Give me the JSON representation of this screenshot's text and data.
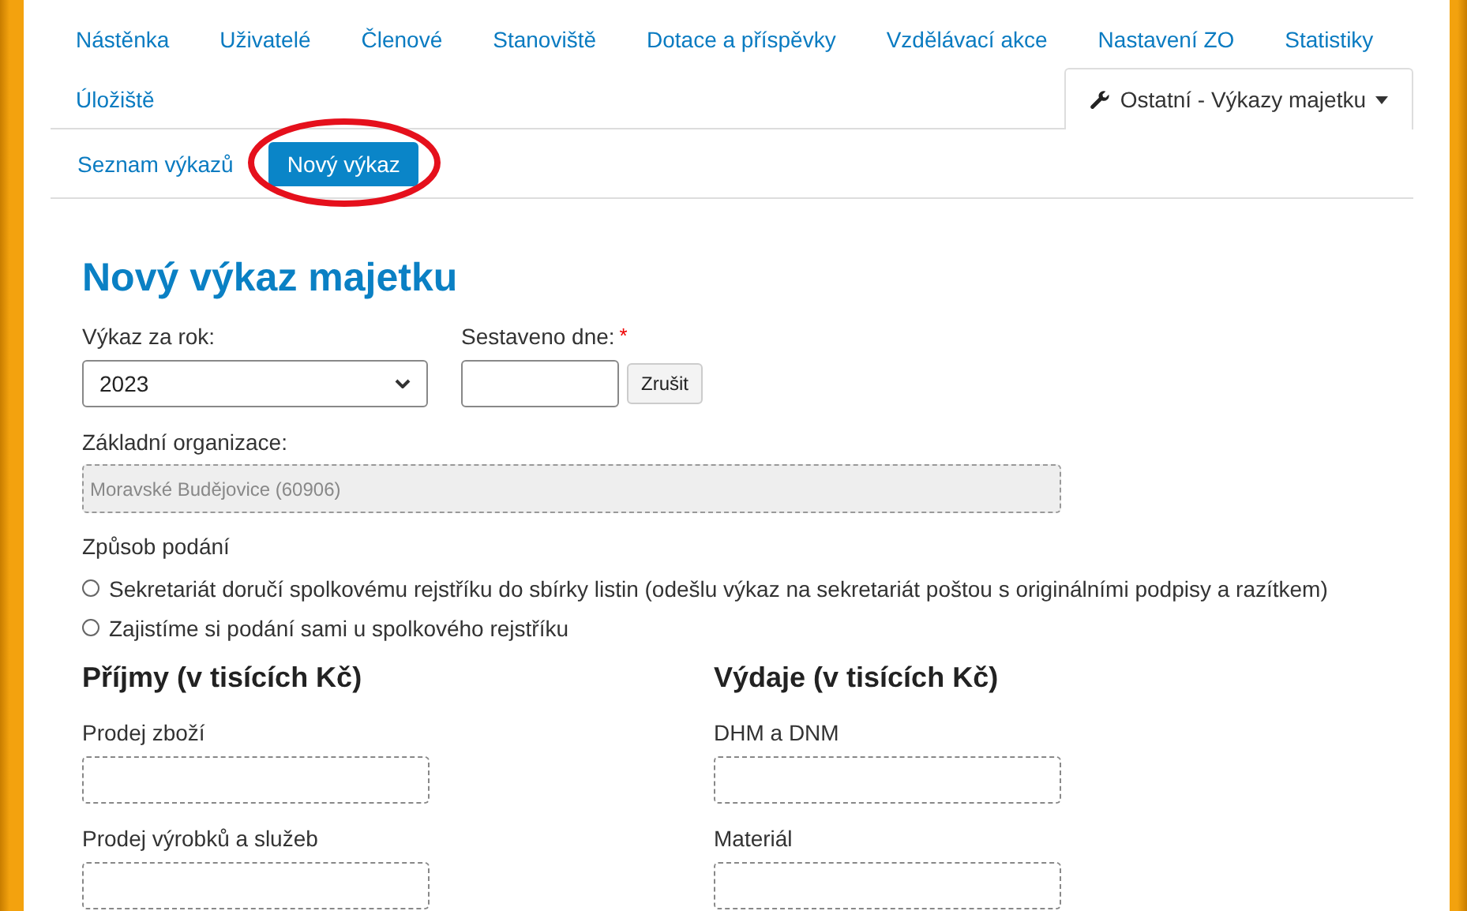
{
  "nav": {
    "tabs": [
      {
        "label": "Nástěnka",
        "selected": false,
        "kind": "link"
      },
      {
        "label": "Uživatelé",
        "selected": false,
        "kind": "link"
      },
      {
        "label": "Členové",
        "selected": false,
        "kind": "link"
      },
      {
        "label": "Stanoviště",
        "selected": false,
        "kind": "link"
      },
      {
        "label": "Dotace a příspěvky",
        "selected": false,
        "kind": "link"
      },
      {
        "label": "Vzdělávací akce",
        "selected": false,
        "kind": "link"
      },
      {
        "label": "Nastavení ZO",
        "selected": false,
        "kind": "link"
      },
      {
        "label": "Statistiky",
        "selected": false,
        "kind": "link"
      },
      {
        "label": "Úložiště",
        "selected": false,
        "kind": "link"
      },
      {
        "label": "Ostatní - Výkazy majetku",
        "selected": true,
        "kind": "dropdown"
      }
    ]
  },
  "subnav": {
    "items": [
      {
        "label": "Seznam výkazů",
        "selected": false,
        "highlighted": false
      },
      {
        "label": "Nový výkaz",
        "selected": true,
        "highlighted": true
      }
    ]
  },
  "form": {
    "title": "Nový výkaz majetku",
    "year": {
      "label": "Výkaz za rok:",
      "value": "2023"
    },
    "date": {
      "label": "Sestaveno dne:",
      "required_mark": "*",
      "cancel": "Zrušit"
    },
    "organization": {
      "label": "Základní organizace:",
      "value": "Moravské Budějovice (60906)",
      "disabled": true
    },
    "filing": {
      "label": "Způsob podání",
      "options": [
        {
          "label": "Sekretariát doručí spolkovému rejstříku do sbírky listin (odešlu výkaz na sekretariát poštou s originálními podpisy a razítkem)",
          "selected": false
        },
        {
          "label": "Zajistíme si podání sami u spolkového rejstříku",
          "selected": false
        }
      ]
    },
    "sections": [
      {
        "title": "Příjmy (v tisících Kč)",
        "fields": [
          {
            "label": "Prodej zboží"
          },
          {
            "label": "Prodej výrobků a služeb"
          }
        ]
      },
      {
        "title": "Výdaje (v tisících Kč)",
        "fields": [
          {
            "label": "DHM a DNM"
          },
          {
            "label": "Materiál"
          }
        ]
      }
    ]
  }
}
